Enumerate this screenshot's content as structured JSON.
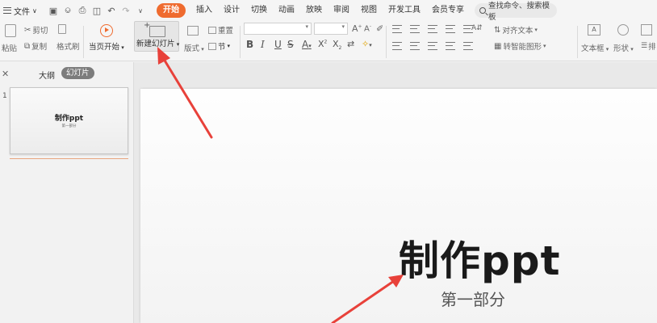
{
  "menubar": {
    "file_label": "文件",
    "tabs": [
      {
        "label": "开始"
      },
      {
        "label": "插入"
      },
      {
        "label": "设计"
      },
      {
        "label": "切换"
      },
      {
        "label": "动画"
      },
      {
        "label": "放映"
      },
      {
        "label": "审阅"
      },
      {
        "label": "视图"
      },
      {
        "label": "开发工具"
      },
      {
        "label": "会员专享"
      }
    ],
    "search_placeholder": "查找命令、搜索模板"
  },
  "ribbon": {
    "paste": "粘贴",
    "cut": "剪切",
    "copy": "复制",
    "format_painter": "格式刷",
    "from_current": "当页开始",
    "new_slide": "新建幻灯片",
    "layout": "版式",
    "reset": "重置",
    "section": "节",
    "align_text": "对齐文本",
    "smart_art": "转智能图形",
    "textbox": "文本框",
    "shape": "形状",
    "arrange": "排"
  },
  "panel": {
    "outline_tab": "大纲",
    "slides_tab": "幻灯片",
    "slide_number": "1",
    "thumb_title": "制作ppt",
    "thumb_subtitle": "第一部分"
  },
  "slide": {
    "title": "制作ppt",
    "subtitle": "第一部分"
  },
  "colors": {
    "accent": "#ef6b2f",
    "arrow": "#e8413a"
  }
}
